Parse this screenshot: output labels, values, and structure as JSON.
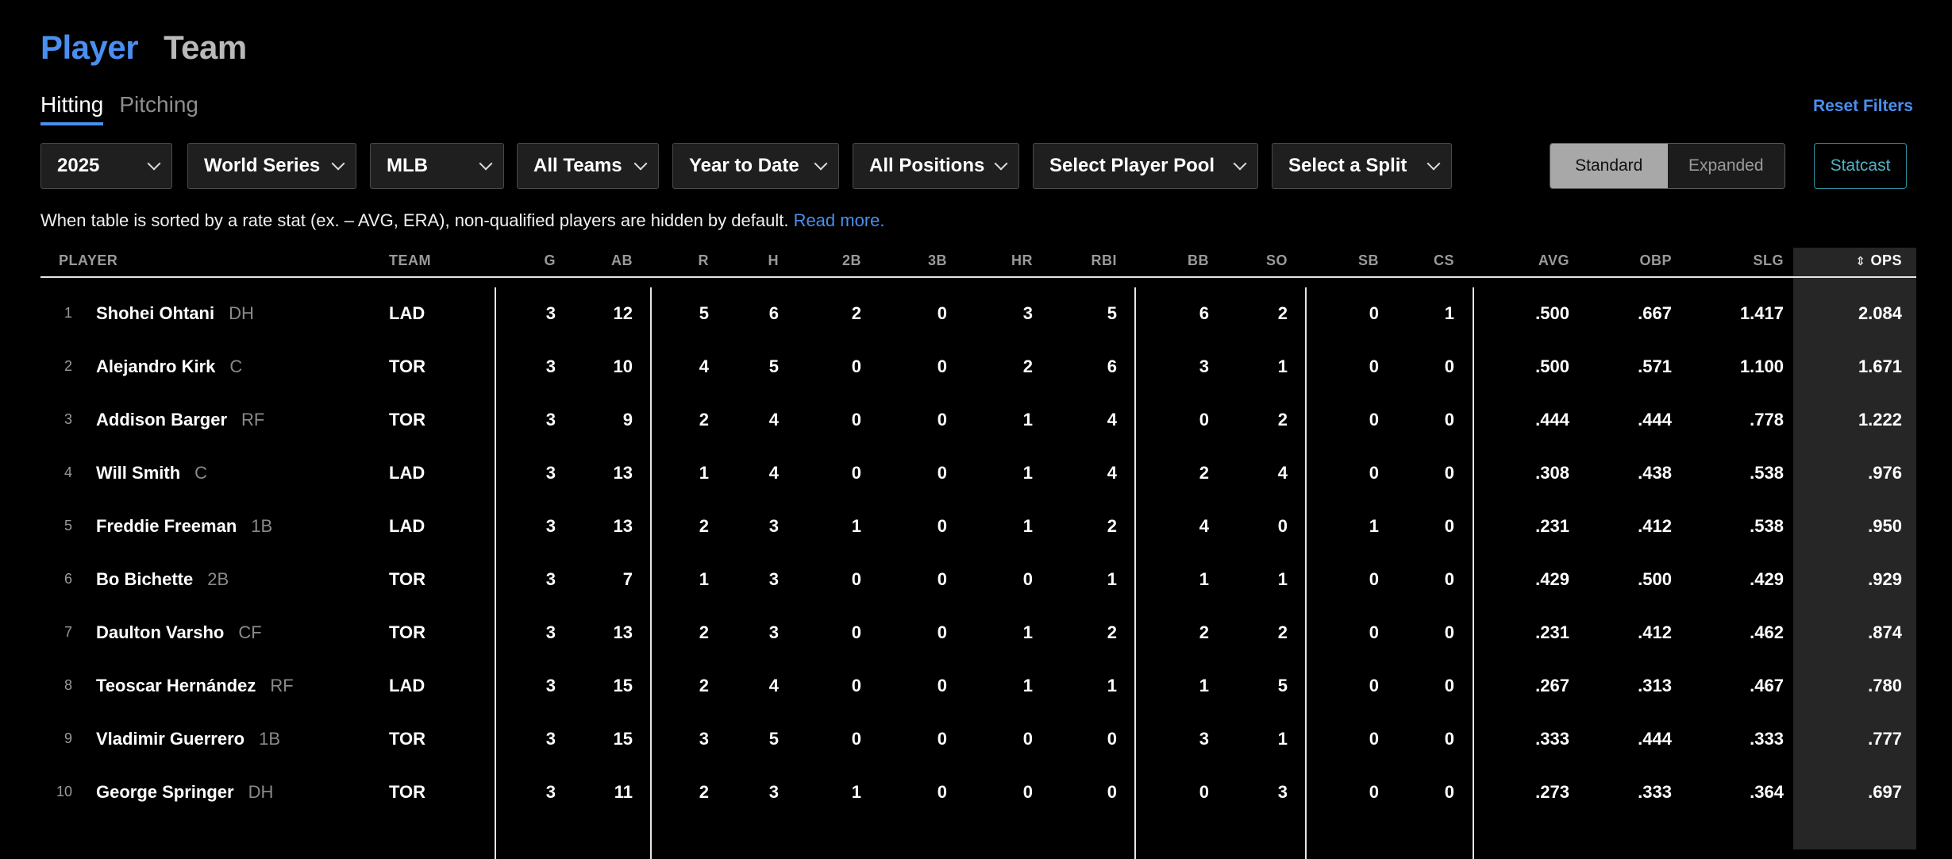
{
  "top_tabs": [
    {
      "label": "Player",
      "active": true
    },
    {
      "label": "Team",
      "active": false
    }
  ],
  "sub_tabs": [
    {
      "label": "Hitting",
      "active": true
    },
    {
      "label": "Pitching",
      "active": false
    }
  ],
  "reset_label": "Reset Filters",
  "filters": [
    {
      "value": "2025"
    },
    {
      "value": "World Series"
    },
    {
      "value": "MLB"
    },
    {
      "value": "All Teams"
    },
    {
      "value": "Year to Date"
    },
    {
      "value": "All Positions"
    },
    {
      "value": "Select Player Pool"
    },
    {
      "value": "Select a Split"
    }
  ],
  "view_toggle": {
    "standard": "Standard",
    "expanded": "Expanded",
    "selected": "Standard"
  },
  "statcast_label": "Statcast",
  "notice": {
    "text": "When table is sorted by a rate stat (ex. – AVG, ERA), non-qualified players are hidden by default.",
    "link": "Read more."
  },
  "columns": [
    "PLAYER",
    "TEAM",
    "G",
    "AB",
    "R",
    "H",
    "2B",
    "3B",
    "HR",
    "RBI",
    "BB",
    "SO",
    "SB",
    "CS",
    "AVG",
    "OBP",
    "SLG",
    "OPS"
  ],
  "sort": {
    "column": "OPS",
    "icon": "sort-arrows-icon"
  },
  "rows": [
    {
      "rank": "1",
      "name": "Shohei Ohtani",
      "pos": "DH",
      "team": "LAD",
      "stats": [
        "3",
        "12",
        "5",
        "6",
        "2",
        "0",
        "3",
        "5",
        "6",
        "2",
        "0",
        "1",
        ".500",
        ".667",
        "1.417",
        "2.084"
      ]
    },
    {
      "rank": "2",
      "name": "Alejandro Kirk",
      "pos": "C",
      "team": "TOR",
      "stats": [
        "3",
        "10",
        "4",
        "5",
        "0",
        "0",
        "2",
        "6",
        "3",
        "1",
        "0",
        "0",
        ".500",
        ".571",
        "1.100",
        "1.671"
      ]
    },
    {
      "rank": "3",
      "name": "Addison Barger",
      "pos": "RF",
      "team": "TOR",
      "stats": [
        "3",
        "9",
        "2",
        "4",
        "0",
        "0",
        "1",
        "4",
        "0",
        "2",
        "0",
        "0",
        ".444",
        ".444",
        ".778",
        "1.222"
      ]
    },
    {
      "rank": "4",
      "name": "Will Smith",
      "pos": "C",
      "team": "LAD",
      "stats": [
        "3",
        "13",
        "1",
        "4",
        "0",
        "0",
        "1",
        "4",
        "2",
        "4",
        "0",
        "0",
        ".308",
        ".438",
        ".538",
        ".976"
      ]
    },
    {
      "rank": "5",
      "name": "Freddie Freeman",
      "pos": "1B",
      "team": "LAD",
      "stats": [
        "3",
        "13",
        "2",
        "3",
        "1",
        "0",
        "1",
        "2",
        "4",
        "0",
        "1",
        "0",
        ".231",
        ".412",
        ".538",
        ".950"
      ]
    },
    {
      "rank": "6",
      "name": "Bo Bichette",
      "pos": "2B",
      "team": "TOR",
      "stats": [
        "3",
        "7",
        "1",
        "3",
        "0",
        "0",
        "0",
        "1",
        "1",
        "1",
        "0",
        "0",
        ".429",
        ".500",
        ".429",
        ".929"
      ]
    },
    {
      "rank": "7",
      "name": "Daulton Varsho",
      "pos": "CF",
      "team": "TOR",
      "stats": [
        "3",
        "13",
        "2",
        "3",
        "0",
        "0",
        "1",
        "2",
        "2",
        "2",
        "0",
        "0",
        ".231",
        ".412",
        ".462",
        ".874"
      ]
    },
    {
      "rank": "8",
      "name": "Teoscar Hernández",
      "pos": "RF",
      "team": "LAD",
      "stats": [
        "3",
        "15",
        "2",
        "4",
        "0",
        "0",
        "1",
        "1",
        "1",
        "5",
        "0",
        "0",
        ".267",
        ".313",
        ".467",
        ".780"
      ]
    },
    {
      "rank": "9",
      "name": "Vladimir Guerrero",
      "pos": "1B",
      "team": "TOR",
      "stats": [
        "3",
        "15",
        "3",
        "5",
        "0",
        "0",
        "0",
        "0",
        "3",
        "1",
        "0",
        "0",
        ".333",
        ".444",
        ".333",
        ".777"
      ]
    },
    {
      "rank": "10",
      "name": "George Springer",
      "pos": "DH",
      "team": "TOR",
      "stats": [
        "3",
        "11",
        "2",
        "3",
        "1",
        "0",
        "0",
        "0",
        "0",
        "3",
        "0",
        "0",
        ".273",
        ".333",
        ".364",
        ".697"
      ]
    }
  ]
}
